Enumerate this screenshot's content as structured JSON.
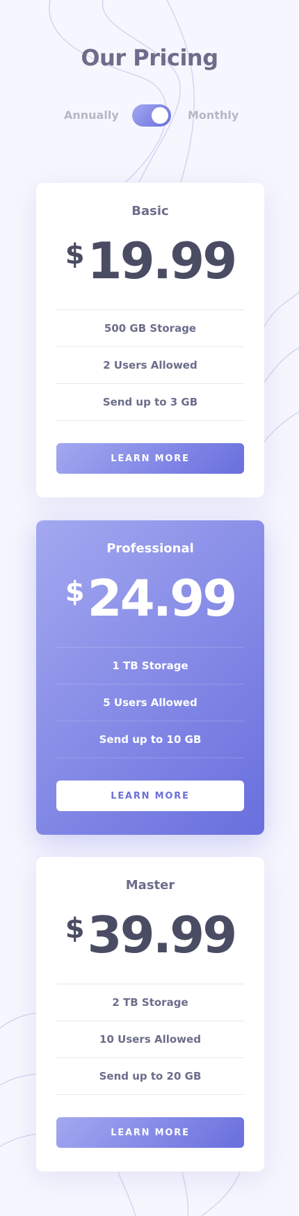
{
  "header": {
    "title": "Our Pricing"
  },
  "billing_toggle": {
    "left_label": "Annually",
    "right_label": "Monthly",
    "selected": "Monthly"
  },
  "plans": [
    {
      "name": "Basic",
      "currency": "$",
      "price": "19.99",
      "features": [
        "500 GB Storage",
        "2 Users Allowed",
        "Send up to 3 GB"
      ],
      "button_label": "LEARN MORE"
    },
    {
      "name": "Professional",
      "currency": "$",
      "price": "24.99",
      "features": [
        "1 TB Storage",
        "5 Users Allowed",
        "Send up to 10 GB"
      ],
      "button_label": "LEARN MORE"
    },
    {
      "name": "Master",
      "currency": "$",
      "price": "39.99",
      "features": [
        "2 TB Storage",
        "10 Users Allowed",
        "Send up to 20 GB"
      ],
      "button_label": "LEARN MORE"
    }
  ],
  "colors": {
    "accent_start": "#a3a8f0",
    "accent_end": "#696fdd",
    "background": "#f6f6fe",
    "heading": "#6b6d8a",
    "price_text": "#4a4c63"
  }
}
